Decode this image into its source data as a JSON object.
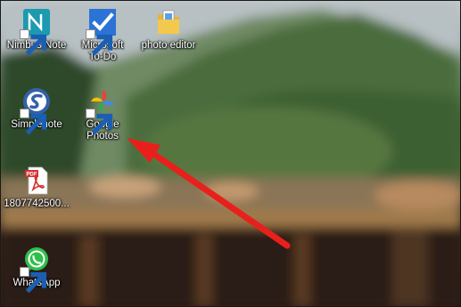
{
  "desktop": {
    "icons": [
      {
        "label": "Nimbus Note",
        "icon": "nimbus-note-icon"
      },
      {
        "label": "Microsoft\nTo-Do",
        "icon": "microsoft-todo-icon"
      },
      {
        "label": "photo editor",
        "icon": "photo-editor-icon"
      },
      {
        "label": "Simplenote",
        "icon": "simplenote-icon"
      },
      {
        "label": "Google\nPhotos",
        "icon": "google-photos-icon"
      },
      {
        "label": "1807742500...",
        "icon": "pdf-file-icon"
      },
      {
        "label": "WhatsApp",
        "icon": "whatsapp-icon"
      }
    ]
  },
  "annotation": {
    "type": "arrow",
    "color": "#e8201c"
  },
  "colors": {
    "label_text": "#ffffff",
    "arrow": "#e8201c"
  }
}
